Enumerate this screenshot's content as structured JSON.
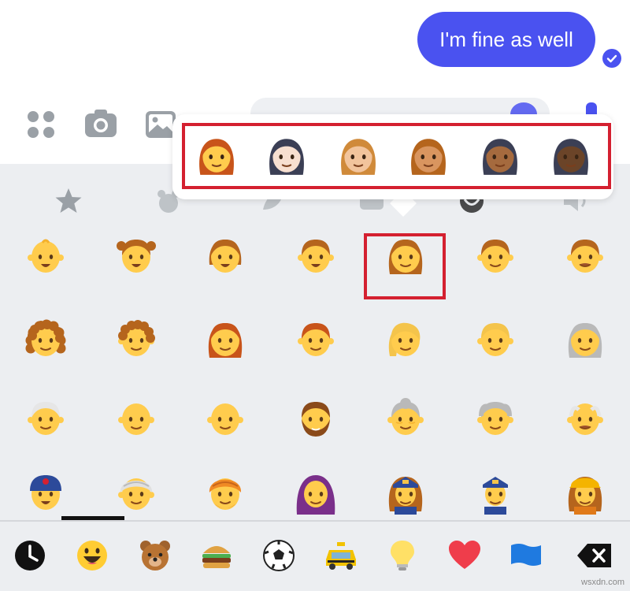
{
  "chat": {
    "message": "I'm fine as well",
    "bubble_color": "#4a52f0",
    "status": "read"
  },
  "composer": {
    "icons": [
      "more-apps-icon",
      "camera-icon",
      "gallery-icon",
      "microphone-icon",
      "emoji-icon",
      "like-icon"
    ]
  },
  "skin_tone_popup": {
    "base_emoji": "woman",
    "tones": [
      "default",
      "light",
      "medium-light",
      "medium",
      "medium-dark",
      "dark"
    ],
    "highlight_color": "#d42030"
  },
  "keyboard": {
    "categories": [
      "favorites",
      "smileys",
      "animals",
      "food",
      "travel",
      "objects",
      "symbols",
      "sounds"
    ],
    "selected_category": "smileys",
    "selected_emoji": "woman",
    "emoji_rows": [
      [
        "baby",
        "girl",
        "boy",
        "child",
        "woman",
        "person-blond",
        "man-mustache"
      ],
      [
        "woman-curly-hair",
        "man-curly-hair",
        "woman-red-hair",
        "man-red-hair",
        "woman-blond-hair",
        "man-blond",
        "woman-white-hair"
      ],
      [
        "man-white-hair",
        "woman-bald",
        "man-bald",
        "man-beard",
        "old-woman",
        "old-man",
        "older-man"
      ],
      [
        "man-with-cap",
        "woman-turban",
        "man-turban",
        "woman-headscarf",
        "woman-police-officer",
        "man-police-officer",
        "woman-construction-worker"
      ]
    ]
  },
  "bottom_bar": {
    "items": [
      "recent-icon",
      "smiley-icon",
      "bear-icon",
      "burger-icon",
      "soccer-ball-icon",
      "taxi-icon",
      "lightbulb-icon",
      "heart-icon",
      "flag-icon",
      "backspace-icon"
    ],
    "active": "recent-icon"
  },
  "watermark": "wsxdn.com"
}
